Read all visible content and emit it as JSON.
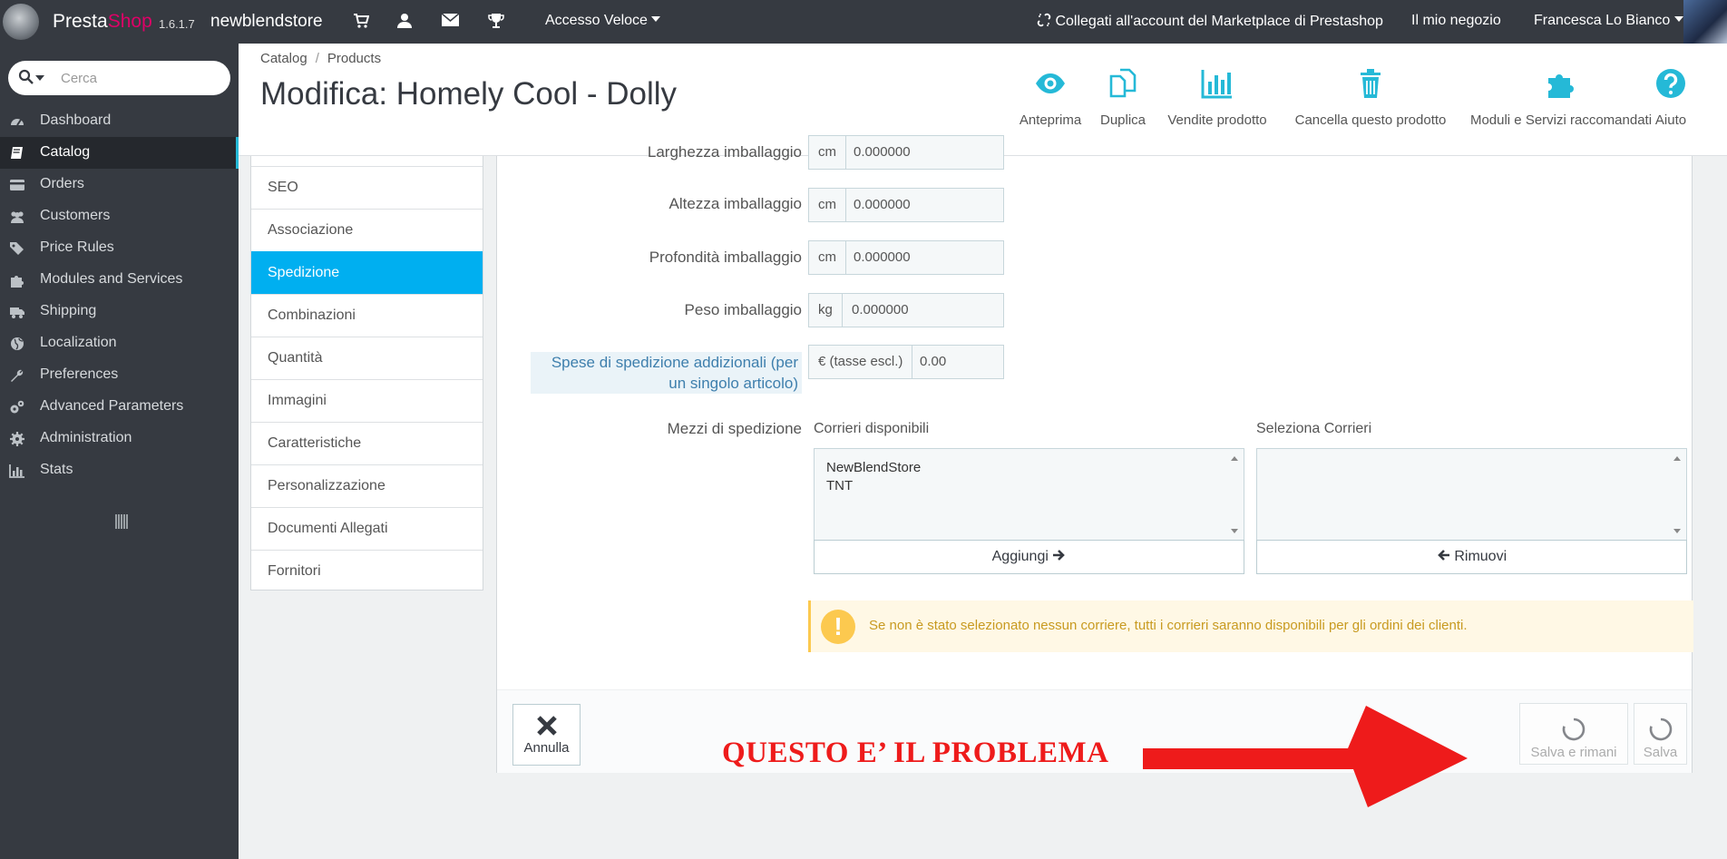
{
  "topbar": {
    "brand_main": "Presta",
    "brand_accent": "Shop",
    "version": "1.6.1.7",
    "shop_name": "newblendstore",
    "quick_access": "Accesso Veloce",
    "marketplace": "Collegati all'account del Marketplace di Prestashop",
    "my_store": "Il mio negozio",
    "user_name": "Francesca Lo Bianco",
    "icons": [
      "cart-icon",
      "user-icon",
      "envelope-icon",
      "trophy-icon"
    ]
  },
  "sidebar": {
    "search_placeholder": "Cerca",
    "items": [
      {
        "label": "Dashboard",
        "icon": "dashboard-icon"
      },
      {
        "label": "Catalog",
        "icon": "book-icon",
        "active": true
      },
      {
        "label": "Orders",
        "icon": "credit-card-icon"
      },
      {
        "label": "Customers",
        "icon": "users-icon"
      },
      {
        "label": "Price Rules",
        "icon": "tags-icon"
      },
      {
        "label": "Modules and Services",
        "icon": "puzzle-icon"
      },
      {
        "label": "Shipping",
        "icon": "truck-icon"
      },
      {
        "label": "Localization",
        "icon": "globe-icon"
      },
      {
        "label": "Preferences",
        "icon": "wrench-icon"
      },
      {
        "label": "Advanced Parameters",
        "icon": "cogs-icon"
      },
      {
        "label": "Administration",
        "icon": "gear-icon"
      },
      {
        "label": "Stats",
        "icon": "bar-chart-icon"
      }
    ]
  },
  "header": {
    "breadcrumb": [
      "Catalog",
      "Products"
    ],
    "title": "Modifica: Homely Cool - Dolly",
    "toolbar": [
      {
        "label": "Anteprima",
        "icon": "eye-icon"
      },
      {
        "label": "Duplica",
        "icon": "copy-icon"
      },
      {
        "label": "Vendite prodotto",
        "icon": "bar-chart-icon"
      },
      {
        "label": "Cancella questo prodotto",
        "icon": "trash-icon"
      },
      {
        "label": "Moduli e Servizi raccomandati",
        "icon": "puzzle-icon"
      },
      {
        "label": "Aiuto",
        "icon": "question-circle-icon"
      }
    ]
  },
  "tabs": [
    {
      "label": "SEO"
    },
    {
      "label": "Associazione"
    },
    {
      "label": "Spedizione",
      "active": true
    },
    {
      "label": "Combinazioni"
    },
    {
      "label": "Quantità"
    },
    {
      "label": "Immagini"
    },
    {
      "label": "Caratteristiche"
    },
    {
      "label": "Personalizzazione"
    },
    {
      "label": "Documenti Allegati"
    },
    {
      "label": "Fornitori"
    }
  ],
  "form": {
    "width": {
      "label": "Larghezza imballaggio",
      "unit": "cm",
      "value": "0.000000"
    },
    "height": {
      "label": "Altezza imballaggio",
      "unit": "cm",
      "value": "0.000000"
    },
    "depth": {
      "label": "Profondità imballaggio",
      "unit": "cm",
      "value": "0.000000"
    },
    "weight": {
      "label": "Peso imballaggio",
      "unit": "kg",
      "value": "0.000000"
    },
    "extra_shipping": {
      "label": "Spese di spedizione addizionali (per un singolo articolo)",
      "unit": "€ (tasse escl.)",
      "value": "0.00"
    },
    "carriers": {
      "label": "Mezzi di spedizione",
      "available_label": "Corrieri disponibili",
      "available": [
        "NewBlendStore",
        "TNT"
      ],
      "selected_label": "Seleziona Corrieri",
      "selected": [],
      "add_button": "Aggiungi",
      "remove_button": "Rimuovi"
    },
    "warning": "Se non è stato selezionato nessun corriere, tutti i corrieri saranno disponibili per gli ordini dei clienti."
  },
  "footer": {
    "cancel": "Annulla",
    "save_stay": "Salva e rimani",
    "save": "Salva"
  },
  "annotation": {
    "text": "QUESTO E’ IL PROBLEMA",
    "color": "#ee1b1b"
  },
  "colors": {
    "accent": "#25b9d7",
    "active_tab": "#00aff0",
    "sidebar_bg": "#363a41",
    "warning": "#fcc94f"
  }
}
